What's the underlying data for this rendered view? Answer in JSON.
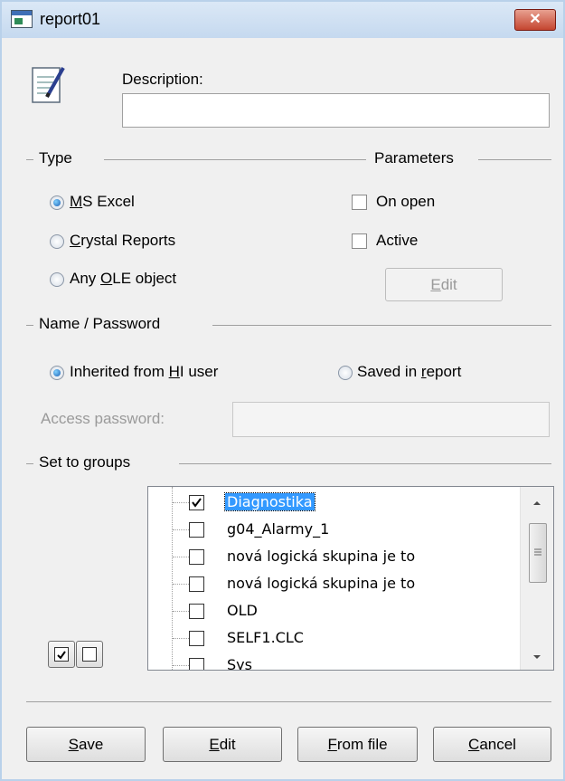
{
  "window": {
    "title": "report01"
  },
  "description": {
    "label": "Description:",
    "value": ""
  },
  "type": {
    "header": "Type",
    "options": [
      {
        "pre": "",
        "key": "M",
        "post": "S Excel",
        "selected": true
      },
      {
        "pre": "",
        "key": "C",
        "post": "rystal Reports",
        "selected": false
      },
      {
        "pre": "Any ",
        "key": "O",
        "post": "LE object",
        "selected": false
      }
    ]
  },
  "parameters": {
    "header": "Parameters",
    "on_open": {
      "label": "On open",
      "checked": false
    },
    "active": {
      "label": "Active",
      "checked": false
    },
    "edit_button": {
      "key": "E",
      "post": "dit"
    }
  },
  "name_password": {
    "header": "Name / Password",
    "inherited": {
      "pre": "Inherited from ",
      "key": "H",
      "post": "I user",
      "selected": true
    },
    "saved": {
      "pre": "Saved in ",
      "key": "r",
      "post": "eport",
      "selected": false
    },
    "access_password": {
      "label": "Access password:",
      "value": ""
    }
  },
  "groups": {
    "header": "Set to groups",
    "items": [
      {
        "label": "Diagnostika",
        "checked": true,
        "selected": true
      },
      {
        "label": "g04_Alarmy_1",
        "checked": false,
        "selected": false
      },
      {
        "label": "nová logická skupina je to",
        "checked": false,
        "selected": false
      },
      {
        "label": "nová logická skupina je to",
        "checked": false,
        "selected": false
      },
      {
        "label": "OLD",
        "checked": false,
        "selected": false
      },
      {
        "label": "SELF1.CLC",
        "checked": false,
        "selected": false
      },
      {
        "label": "Sys",
        "checked": false,
        "selected": false
      }
    ]
  },
  "buttons": {
    "save": {
      "key": "S",
      "post": "ave"
    },
    "edit": {
      "key": "E",
      "post": "dit"
    },
    "from_file": {
      "key": "F",
      "post": "rom file"
    },
    "cancel": {
      "key": "C",
      "post": "ancel"
    }
  },
  "colors": {
    "selection": "#3399ff",
    "title_bar": "#c5d9ef",
    "close": "#c44530"
  }
}
